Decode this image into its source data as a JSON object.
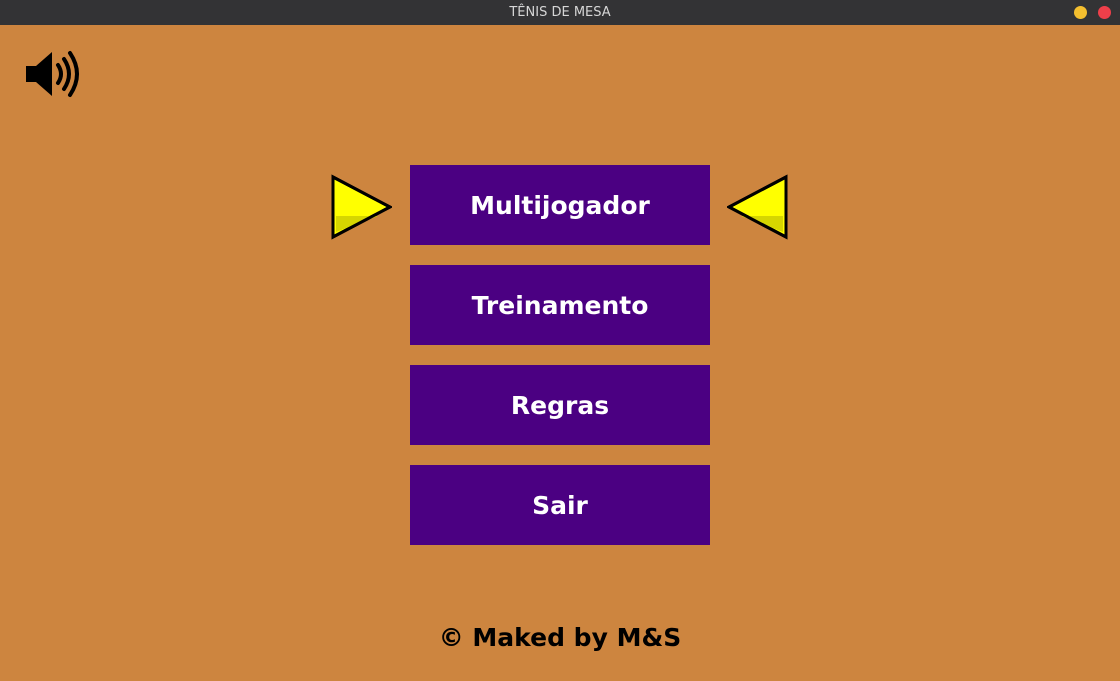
{
  "window": {
    "title": "TÊNIS DE MESA",
    "controls": {
      "minimize_color": "#f4bf2f",
      "close_color": "#ef3f4a"
    }
  },
  "theme": {
    "background": "#cd853f",
    "button_color": "#4b0082",
    "button_text_color": "#ffffff",
    "arrow_color": "#ffff00"
  },
  "sound": {
    "icon": "speaker-volume-icon"
  },
  "menu": {
    "items": [
      {
        "label": "Multijogador",
        "selected": true
      },
      {
        "label": "Treinamento",
        "selected": false
      },
      {
        "label": "Regras",
        "selected": false
      },
      {
        "label": "Sair",
        "selected": false
      }
    ]
  },
  "selection_arrows": {
    "left_icon": "arrow-right-icon",
    "right_icon": "arrow-left-icon"
  },
  "footer": {
    "credit": "© Maked by M&S"
  }
}
